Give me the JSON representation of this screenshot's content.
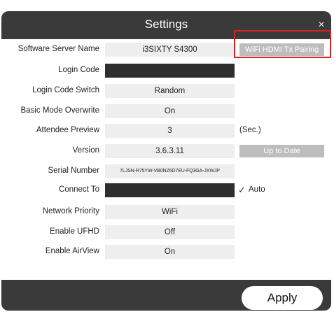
{
  "dialog": {
    "title": "Settings",
    "close_glyph": "×"
  },
  "settings": {
    "server_name": {
      "label": "Software Server Name",
      "value": "i3SIXTY S4300",
      "button": "WiFi HDMI Tx Pairing"
    },
    "login_code": {
      "label": "Login Code",
      "value": ""
    },
    "login_code_switch": {
      "label": "Login Code Switch",
      "value": "Random"
    },
    "basic_mode": {
      "label": "Basic Mode Overwrite",
      "value": "On"
    },
    "attendee_preview": {
      "label": "Attendee Preview",
      "value": "3",
      "unit": "(Sec.)"
    },
    "version": {
      "label": "Version",
      "value": "3.6.3.11",
      "button": "Up to Date"
    },
    "serial_number": {
      "label": "Serial Number",
      "value": "7LJSN-R75YW-VB0NZ6D7EU-FQ3GA-JXWJP"
    },
    "connect_to": {
      "label": "Connect To",
      "value": "",
      "checkbox_label": "Auto",
      "checkbox_glyph": "✓"
    },
    "network_priority": {
      "label": "Network Priority",
      "value": "WiFi"
    },
    "enable_ufhd": {
      "label": "Enable UFHD",
      "value": "Off"
    },
    "enable_airview": {
      "label": "Enable AirView",
      "value": "On"
    }
  },
  "footer": {
    "apply_label": "Apply"
  },
  "colors": {
    "titlebar": "#3a3a3a",
    "field_bg": "#eeeeee",
    "dark_field": "#2e2e2e",
    "disabled_button": "#bdbdbd",
    "highlight_border": "#d62424"
  },
  "icons": {
    "close": "close-icon",
    "check": "checkmark-icon"
  }
}
